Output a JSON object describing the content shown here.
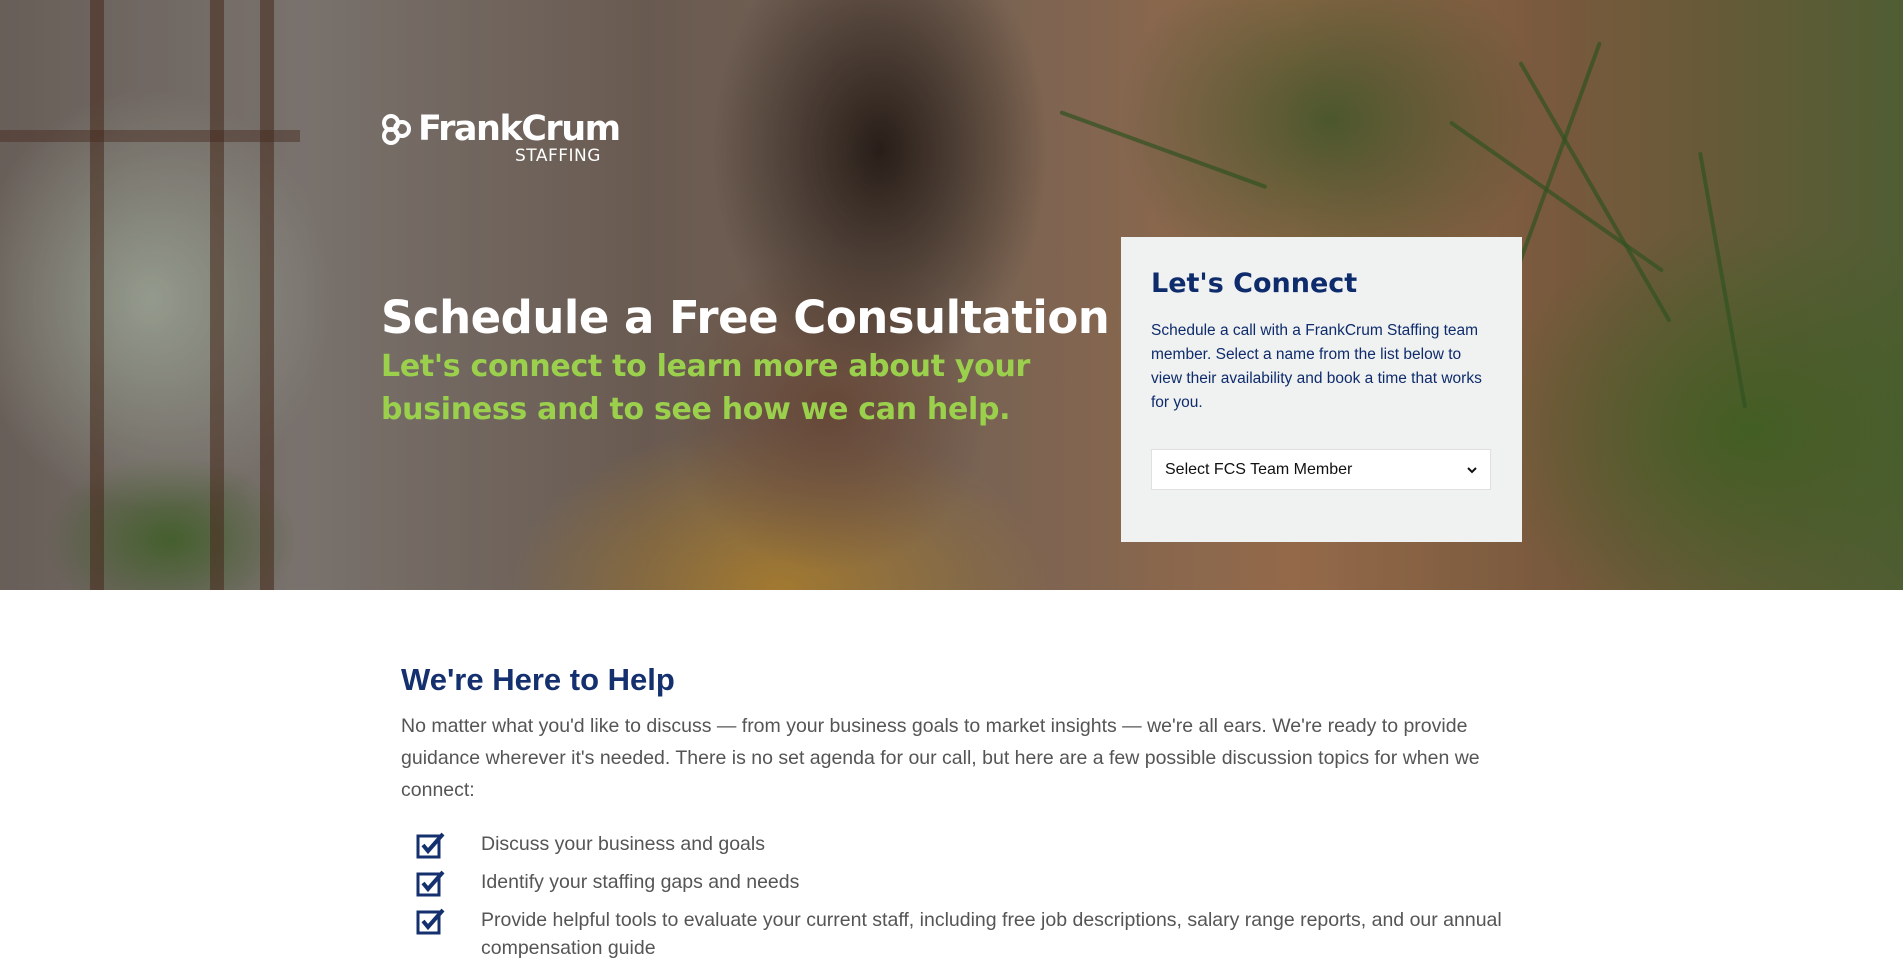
{
  "hero": {
    "logo": {
      "name": "FrankCrum",
      "sub": "STAFFING"
    },
    "title": "Schedule a Free Consultation",
    "subtitle": "Let's connect to learn more about your business and to see how we can help."
  },
  "connect_card": {
    "title": "Let's Connect",
    "text": "Schedule a call with a FrankCrum Staffing team member. Select a name from the list below to view their availability and book a time that works for you.",
    "select": {
      "selected": "Select FCS Team Member",
      "icon": "chevron-down-icon"
    }
  },
  "help": {
    "title": "We're Here to Help",
    "intro": "No matter what you'd like to discuss — from your business goals to market insights — we're all ears. We're ready to provide guidance wherever it's needed. There is no set agenda for our call, but here are a few possible discussion topics for when we connect:",
    "topic_icon": "checkbox-checked-icon",
    "topics": [
      "Discuss your business and goals",
      "Identify your staffing gaps and needs",
      "Provide helpful tools to evaluate your current staff, including free job descriptions, salary range reports, and our annual compensation guide"
    ]
  },
  "colors": {
    "navy": "#0e2c6c",
    "heading_blue": "#14306e",
    "accent_green": "#9bd04d",
    "card_bg": "#f0f1f1",
    "body_text": "#555555"
  }
}
